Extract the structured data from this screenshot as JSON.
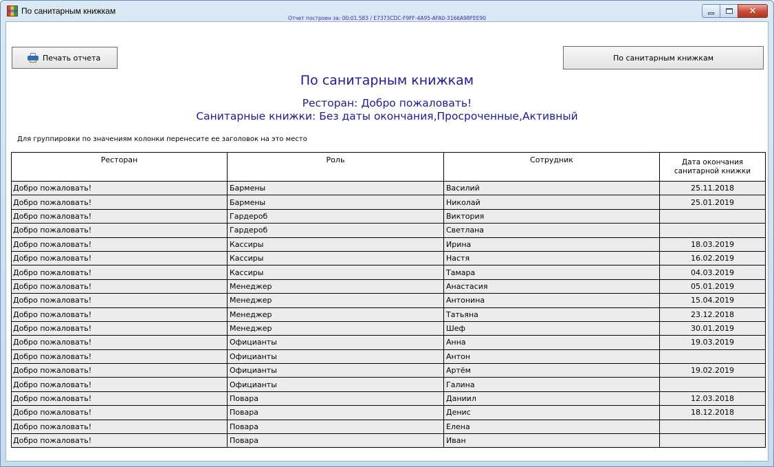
{
  "window": {
    "title": "По санитарным книжкам",
    "controls": {
      "minimize": "minimize",
      "maximize": "maximize",
      "close": "close"
    }
  },
  "build_info": "Отчет построен за: 00:01.583 / E7373CDC-F9FF-4A95-AFA0-3166A98FEE90",
  "buttons": {
    "print_label": "Печать отчета",
    "report_label": "По санитарным книжкам"
  },
  "headings": {
    "title": "По санитарным книжкам",
    "restaurant": "Ресторан: Добро пожаловать!",
    "books": "Санитарные книжки: Без даты окончания,Просроченные,Активный"
  },
  "group_hint": "Для группировки по значениям колонки перенесите ее заголовок на это место",
  "table": {
    "columns": [
      "Ресторан",
      "Роль",
      "Сотрудник",
      "Дата окончания санитарной книжки"
    ],
    "rows": [
      [
        "Добро пожаловать!",
        "Бармены",
        "Василий",
        "25.11.2018"
      ],
      [
        "Добро пожаловать!",
        "Бармены",
        "Николай",
        "25.01.2019"
      ],
      [
        "Добро пожаловать!",
        "Гардероб",
        "Виктория",
        ""
      ],
      [
        "Добро пожаловать!",
        "Гардероб",
        "Светлана",
        ""
      ],
      [
        "Добро пожаловать!",
        "Кассиры",
        "Ирина",
        "18.03.2019"
      ],
      [
        "Добро пожаловать!",
        "Кассиры",
        "Настя",
        "16.02.2019"
      ],
      [
        "Добро пожаловать!",
        "Кассиры",
        "Тамара",
        "04.03.2019"
      ],
      [
        "Добро пожаловать!",
        "Менеджер",
        "Анастасия",
        "05.01.2019"
      ],
      [
        "Добро пожаловать!",
        "Менеджер",
        "Антонина",
        "15.04.2019"
      ],
      [
        "Добро пожаловать!",
        "Менеджер",
        "Татьяна",
        "23.12.2018"
      ],
      [
        "Добро пожаловать!",
        "Менеджер",
        "Шеф",
        "30.01.2019"
      ],
      [
        "Добро пожаловать!",
        "Официанты",
        "Анна",
        "19.03.2019"
      ],
      [
        "Добро пожаловать!",
        "Официанты",
        "Антон",
        ""
      ],
      [
        "Добро пожаловать!",
        "Официанты",
        "Артём",
        "19.02.2019"
      ],
      [
        "Добро пожаловать!",
        "Официанты",
        "Галина",
        ""
      ],
      [
        "Добро пожаловать!",
        "Повара",
        "Даниил",
        "12.03.2018"
      ],
      [
        "Добро пожаловать!",
        "Повара",
        "Денис",
        "18.12.2018"
      ],
      [
        "Добро пожаловать!",
        "Повара",
        "Елена",
        ""
      ],
      [
        "Добро пожаловать!",
        "Повара",
        "Иван",
        ""
      ]
    ]
  }
}
